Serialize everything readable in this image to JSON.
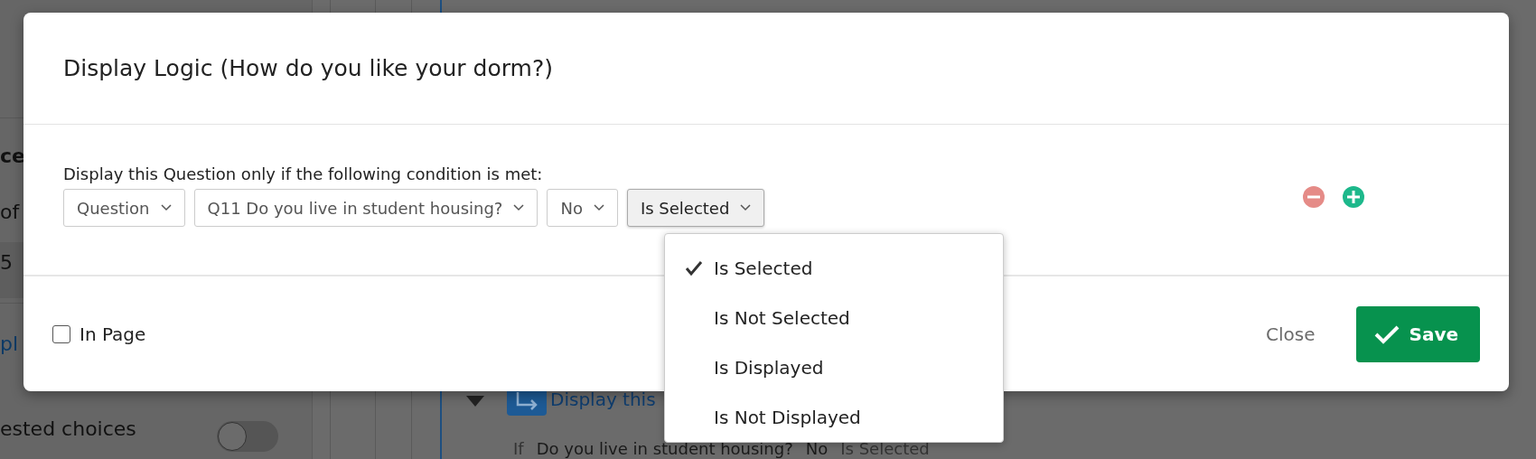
{
  "background": {
    "left_texts": [
      {
        "text": "ce",
        "kind": "heading"
      },
      {
        "text": "of",
        "kind": "plain"
      },
      {
        "text": "5",
        "kind": "shaded"
      },
      {
        "text": "pl",
        "kind": "link"
      },
      {
        "text": "ested choices",
        "kind": "plain"
      }
    ],
    "toggle": {
      "on": false
    },
    "bottom_block": {
      "title": "Display this",
      "condition": [
        "If",
        "Do you live in student housing?",
        "No",
        "Is Selected"
      ]
    }
  },
  "dialog": {
    "title": "Display Logic (How do you like your dorm?)",
    "prompt": "Display this Question only if the following condition is met:",
    "selectors": [
      {
        "value": "Question",
        "open": false
      },
      {
        "value": "Q11 Do you live in student housing?",
        "open": false
      },
      {
        "value": "No",
        "open": false
      },
      {
        "value": "Is Selected",
        "open": true
      }
    ],
    "menu": [
      {
        "label": "Is Selected",
        "selected": true
      },
      {
        "label": "Is Not Selected",
        "selected": false
      },
      {
        "label": "Is Displayed",
        "selected": false
      },
      {
        "label": "Is Not Displayed",
        "selected": false
      }
    ],
    "in_page": {
      "label": "In Page",
      "checked": false
    },
    "close": "Close",
    "save": "Save"
  }
}
